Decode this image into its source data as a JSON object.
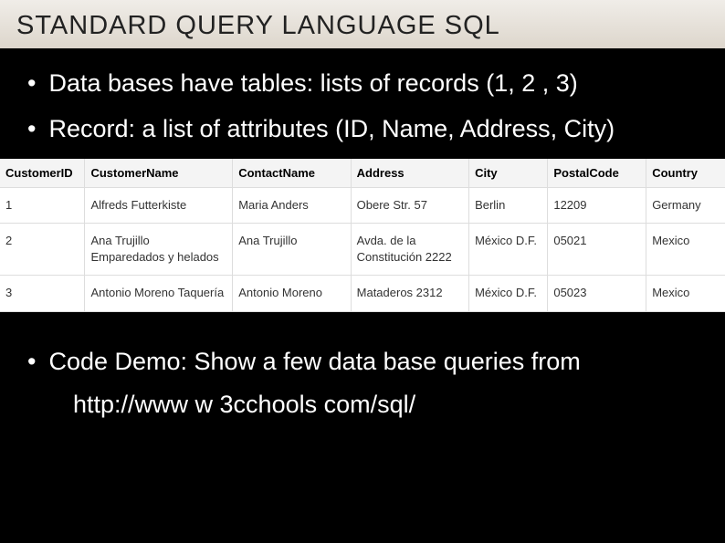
{
  "title": "STANDARD QUERY LANGUAGE  SQL",
  "bullets": {
    "b1": "Data bases have tables: lists of records (1, 2 , 3)",
    "b2": "Record: a list of attributes (ID, Name, Address, City)",
    "b3": "Code Demo:  Show a few data base queries from"
  },
  "link_partial": "http://www w 3cchools com/sql/",
  "table": {
    "headers": {
      "id": "CustomerID",
      "cname": "CustomerName",
      "contact": "ContactName",
      "addr": "Address",
      "city": "City",
      "postal": "PostalCode",
      "country": "Country"
    },
    "rows": [
      {
        "id": "1",
        "cname": "Alfreds Futterkiste",
        "contact": "Maria Anders",
        "addr": "Obere Str. 57",
        "city": "Berlin",
        "postal": "12209",
        "country": "Germany"
      },
      {
        "id": "2",
        "cname": "Ana Trujillo Emparedados y helados",
        "contact": "Ana Trujillo",
        "addr": "Avda. de la Constitución 2222",
        "city": "México D.F.",
        "postal": "05021",
        "country": "Mexico"
      },
      {
        "id": "3",
        "cname": "Antonio Moreno Taquería",
        "contact": "Antonio Moreno",
        "addr": "Mataderos 2312",
        "city": "México D.F.",
        "postal": "05023",
        "country": "Mexico"
      }
    ]
  }
}
